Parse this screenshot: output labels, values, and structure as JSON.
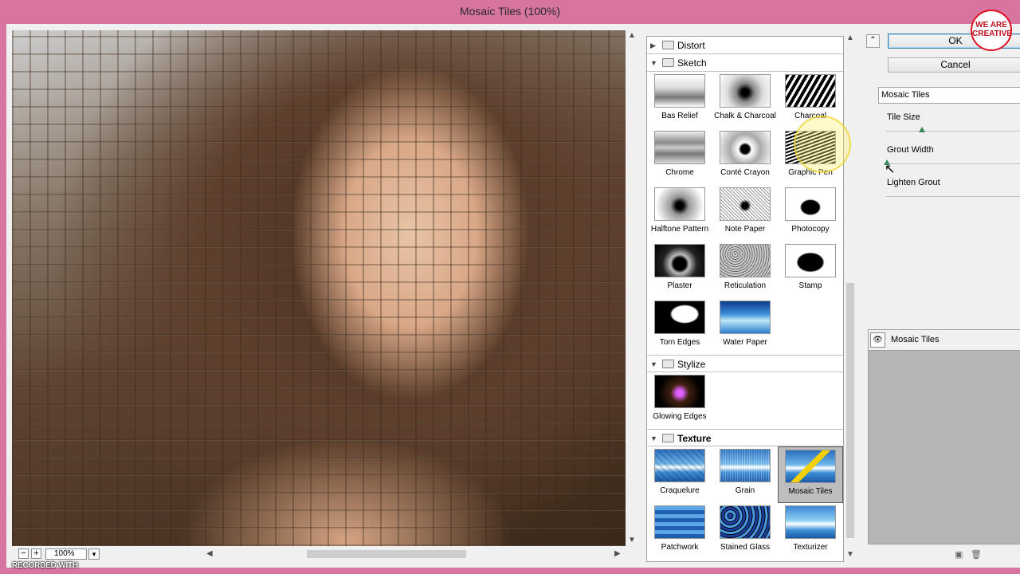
{
  "window": {
    "title": "Mosaic Tiles (100%)"
  },
  "preview": {
    "zoom_out": "−",
    "zoom_in": "+",
    "zoom_value": "100%",
    "zoom_dropdown": "▾"
  },
  "watermark": {
    "recorded_with": "RECORDED WITH"
  },
  "gallery": {
    "categories": [
      {
        "name": "Distort",
        "expanded": false
      },
      {
        "name": "Sketch",
        "expanded": true,
        "filters": [
          "Bas Relief",
          "Chalk & Charcoal",
          "Charcoal",
          "Chrome",
          "Conté Crayon",
          "Graphic Pen",
          "Halftone Pattern",
          "Note Paper",
          "Photocopy",
          "Plaster",
          "Reticulation",
          "Stamp",
          "Torn Edges",
          "Water Paper"
        ]
      },
      {
        "name": "Stylize",
        "expanded": true,
        "filters": [
          "Glowing Edges"
        ]
      },
      {
        "name": "Texture",
        "expanded": true,
        "filters": [
          "Craquelure",
          "Grain",
          "Mosaic Tiles",
          "Patchwork",
          "Stained Glass",
          "Texturizer"
        ]
      }
    ],
    "selected_filter": "Mosaic Tiles"
  },
  "right_panel": {
    "ok_label": "OK",
    "cancel_label": "Cancel",
    "filter_select": "Mosaic Tiles",
    "params": {
      "tile_size": {
        "label": "Tile Size"
      },
      "grout_width": {
        "label": "Grout Width"
      },
      "lighten_grout": {
        "label": "Lighten Grout"
      }
    },
    "effect_layer": "Mosaic Tiles"
  },
  "logo": {
    "line1": "WE ARE",
    "line2": "CREATIVE"
  },
  "colors": {
    "title_bar": "#d874a0",
    "dialog_bg": "#f0f0f0",
    "selected_thumb": "#bdbdbd"
  }
}
